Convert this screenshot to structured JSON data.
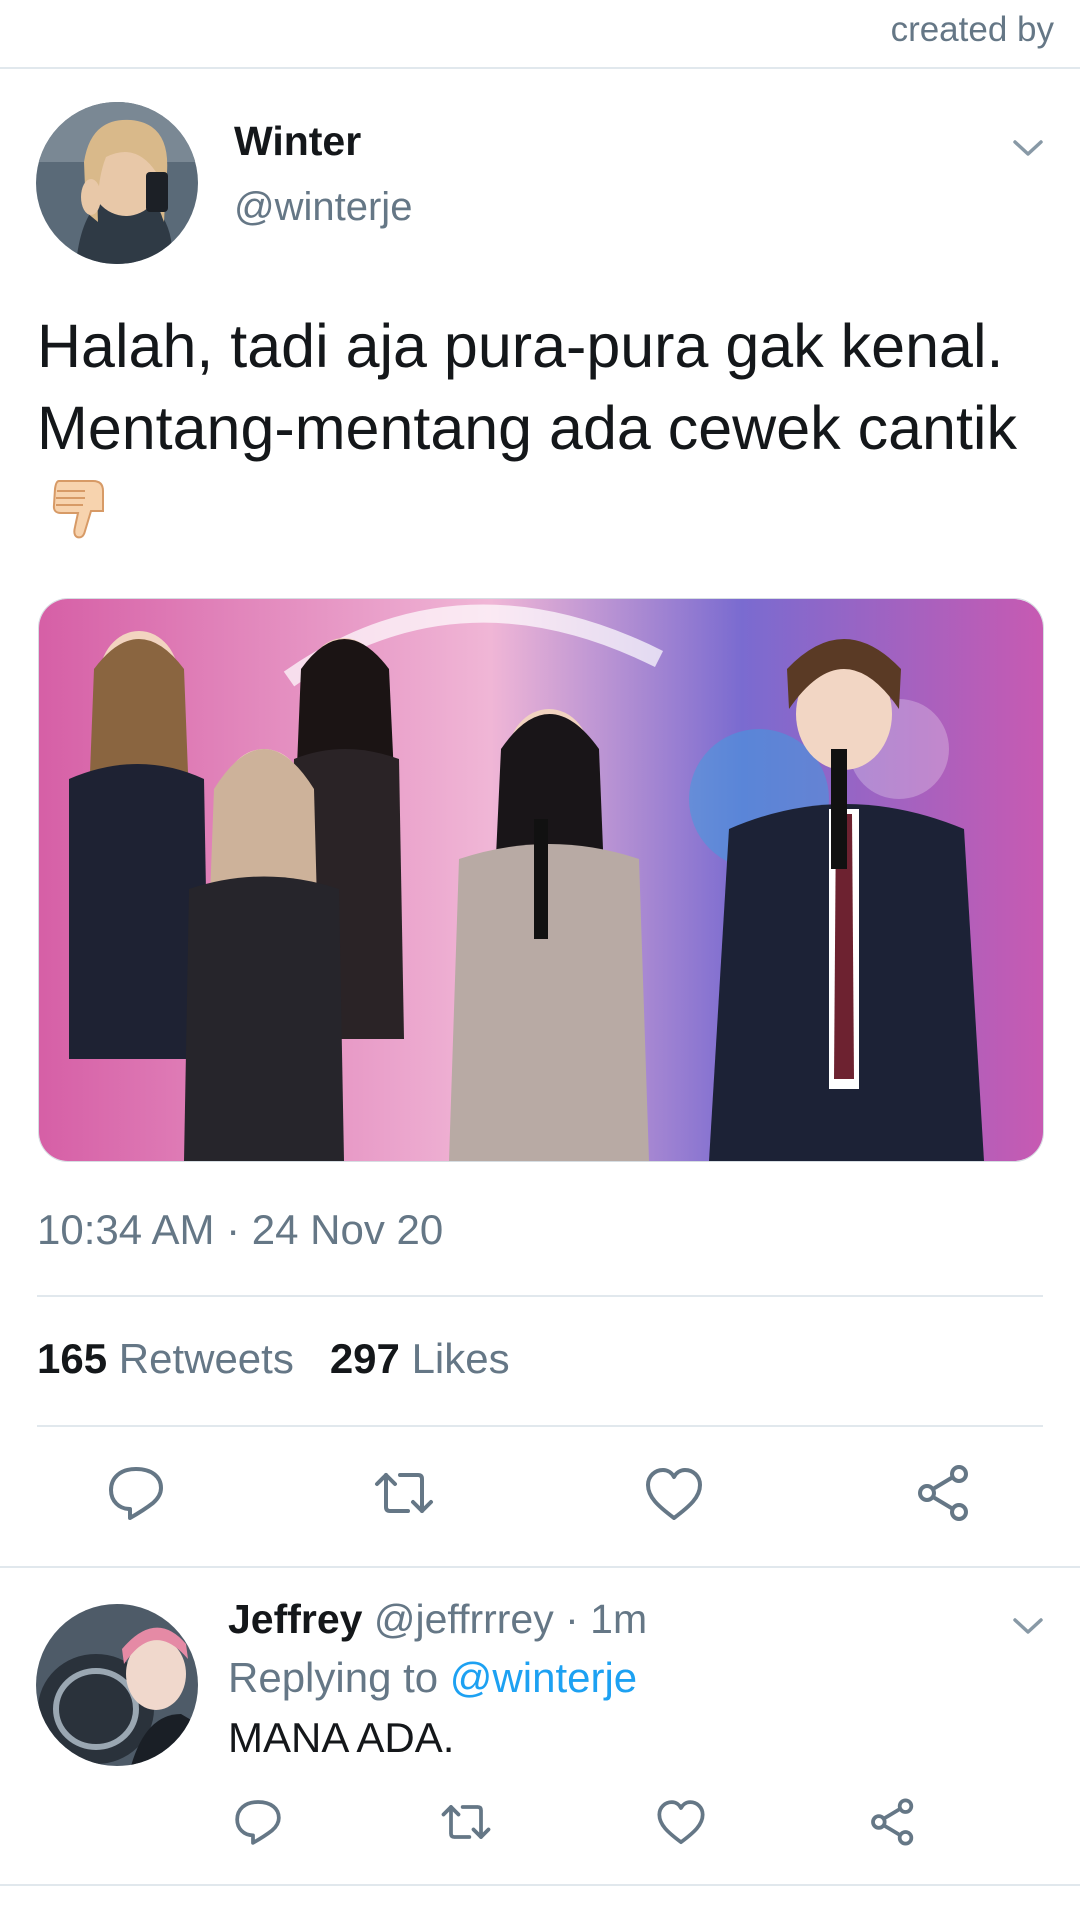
{
  "watermark": "created by",
  "tweet": {
    "author_name": "Winter",
    "author_handle": "@winterje",
    "text": "Halah, tadi aja pura-pura gak kenal. Mentang-mentang ada cewek cantik",
    "emoji": "thumbs-down",
    "media": "photo",
    "timestamp": "10:34 AM · 24 Nov 20",
    "retweets_count": "165",
    "retweets_label": "Retweets",
    "likes_count": "297",
    "likes_label": "Likes",
    "actions": [
      "reply-icon",
      "retweet-icon",
      "like-icon",
      "share-icon"
    ]
  },
  "reply": {
    "author_name": "Jeffrey",
    "author_handle": "@jeffrrrey",
    "time": "1m",
    "replying_prefix": "Replying to",
    "replying_to": "@winterje",
    "text": "MANA ADA.",
    "actions": [
      "reply-icon",
      "retweet-icon",
      "like-icon",
      "share-icon"
    ]
  },
  "colors": {
    "secondary_text": "#657786",
    "link": "#1da1f2",
    "divider": "#e1e8ed"
  }
}
